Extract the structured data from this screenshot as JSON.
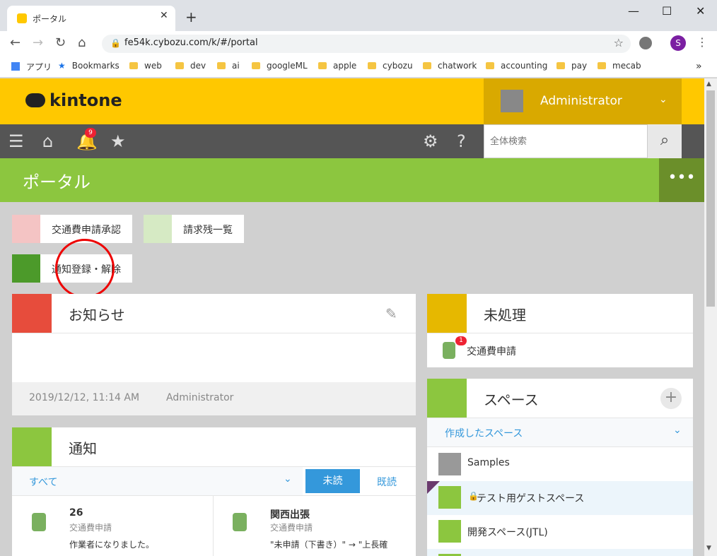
{
  "browser": {
    "tab_title": "ポータル",
    "url": "fe54k.cybozu.com/k/#/portal",
    "profile_letter": "S",
    "bookmarks": [
      "アプリ",
      "Bookmarks",
      "web",
      "dev",
      "ai",
      "googleML",
      "apple",
      "cybozu",
      "chatwork",
      "accounting",
      "pay",
      "mecab"
    ]
  },
  "kintone": {
    "logo": "kintone",
    "user": "Administrator",
    "notification_count": "9",
    "search_placeholder": "全体検索",
    "page_title": "ポータル",
    "app_links": [
      "交通費申請承認",
      "請求残一覧",
      "通知登録・解除"
    ]
  },
  "announce": {
    "title": "お知らせ",
    "date": "2019/12/12, 11:14 AM",
    "author": "Administrator"
  },
  "notify": {
    "title": "通知",
    "filter": "すべて",
    "tab_unread": "未読",
    "tab_read": "既読",
    "items": [
      {
        "title": "26",
        "app": "交通費申請",
        "body": "作業者になりました。"
      },
      {
        "title": "関西出張",
        "app": "交通費申請",
        "body": "\"未申請（下書き）\" → \"上長確"
      }
    ]
  },
  "pending": {
    "title": "未処理",
    "count": "1",
    "item": "交通費申請"
  },
  "spaces": {
    "title": "スペース",
    "filter": "作成したスペース",
    "items": [
      "Samples",
      "テスト用ゲストスペース",
      "開発スペース(JTL)"
    ]
  },
  "colors": {
    "kintone_yellow": "#ffc800",
    "portal_green": "#8cc63f",
    "accent_blue": "#3498db"
  }
}
